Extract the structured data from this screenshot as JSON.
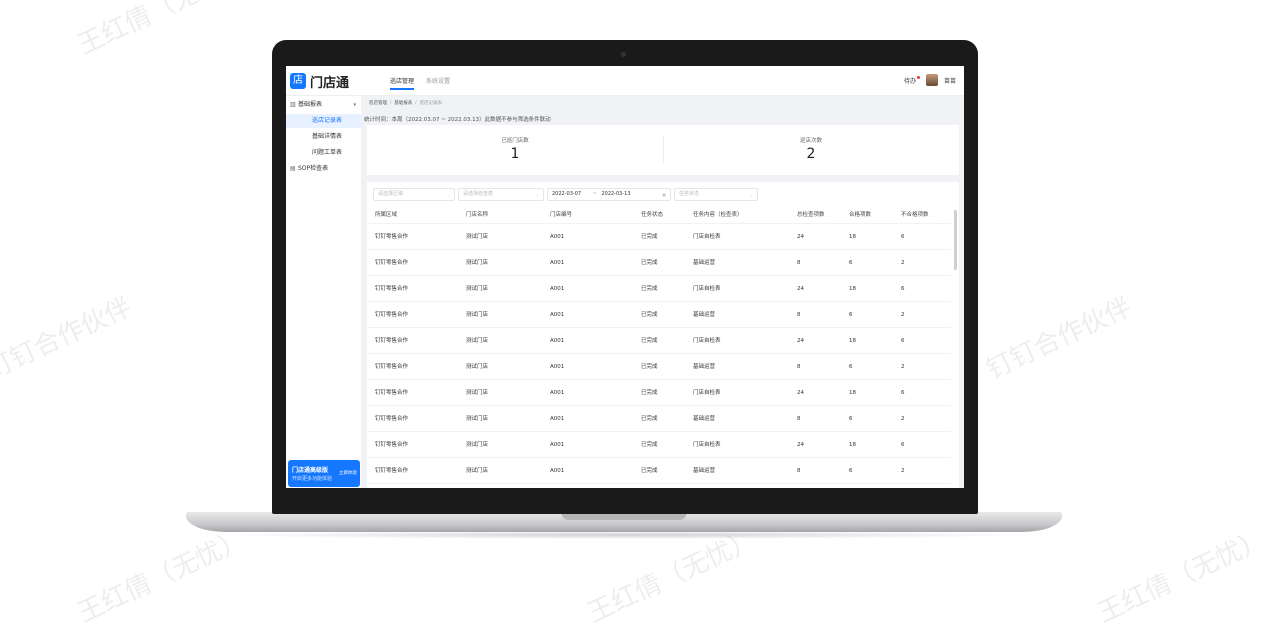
{
  "watermarks": [
    "王红倩（无忧）",
    "钉钉合作伙伴",
    "钉钉合作伙伴",
    "钉钉合作伙伴",
    "王红倩（无忧）",
    "王红倩（无忧）",
    "王红倩（无忧）"
  ],
  "app": {
    "logo_glyph": "店",
    "name": "门店通",
    "nav": [
      "巡店管理",
      "系统设置"
    ],
    "todo": "待办",
    "user": "苗苗"
  },
  "sidebar": {
    "group1": "基础报表",
    "items": [
      "巡店记录表",
      "基础详情表",
      "问题工单表"
    ],
    "group2": "SOP检查表",
    "promo_title": "门店通高级版",
    "promo_sub": "开启更多功能体验",
    "promo_btn": "立即体验"
  },
  "breadcrumb": [
    "巡店管理",
    "基础报表",
    "巡店记录表"
  ],
  "stat_tip": "统计时间：本周（2022.03.07 ~ 2022.03.13）此数据不参与筛选条件联动",
  "stats": [
    {
      "label": "已巡门店数",
      "value": "1"
    },
    {
      "label": "巡店次数",
      "value": "2"
    }
  ],
  "filters": {
    "region": "请选择区域",
    "form": "请选择检查表",
    "date_start": "2022-03-07",
    "date_sep": "~",
    "date_end": "2022-03-13",
    "status": "任务状态"
  },
  "table": {
    "headers": [
      "所属区域",
      "门店名称",
      "门店编号",
      "任务状态",
      "任务内容（检查表）",
      "总检查项数",
      "合格项数",
      "不合格项数"
    ],
    "rows": [
      [
        "钉钉零售合作",
        "测试门店",
        "A001",
        "已完成",
        "门店自检表",
        "24",
        "18",
        "6"
      ],
      [
        "钉钉零售合作",
        "测试门店",
        "A001",
        "已完成",
        "基础运营",
        "8",
        "6",
        "2"
      ],
      [
        "钉钉零售合作",
        "测试门店",
        "A001",
        "已完成",
        "门店自检表",
        "24",
        "18",
        "6"
      ],
      [
        "钉钉零售合作",
        "测试门店",
        "A001",
        "已完成",
        "基础运营",
        "8",
        "6",
        "2"
      ],
      [
        "钉钉零售合作",
        "测试门店",
        "A001",
        "已完成",
        "门店自检表",
        "24",
        "18",
        "6"
      ],
      [
        "钉钉零售合作",
        "测试门店",
        "A001",
        "已完成",
        "基础运营",
        "8",
        "6",
        "2"
      ],
      [
        "钉钉零售合作",
        "测试门店",
        "A001",
        "已完成",
        "门店自检表",
        "24",
        "18",
        "6"
      ],
      [
        "钉钉零售合作",
        "测试门店",
        "A001",
        "已完成",
        "基础运营",
        "8",
        "6",
        "2"
      ],
      [
        "钉钉零售合作",
        "测试门店",
        "A001",
        "已完成",
        "门店自检表",
        "24",
        "18",
        "6"
      ],
      [
        "钉钉零售合作",
        "测试门店",
        "A001",
        "已完成",
        "基础运营",
        "8",
        "6",
        "2"
      ]
    ]
  },
  "colors": {
    "accent": "#1677ff"
  }
}
